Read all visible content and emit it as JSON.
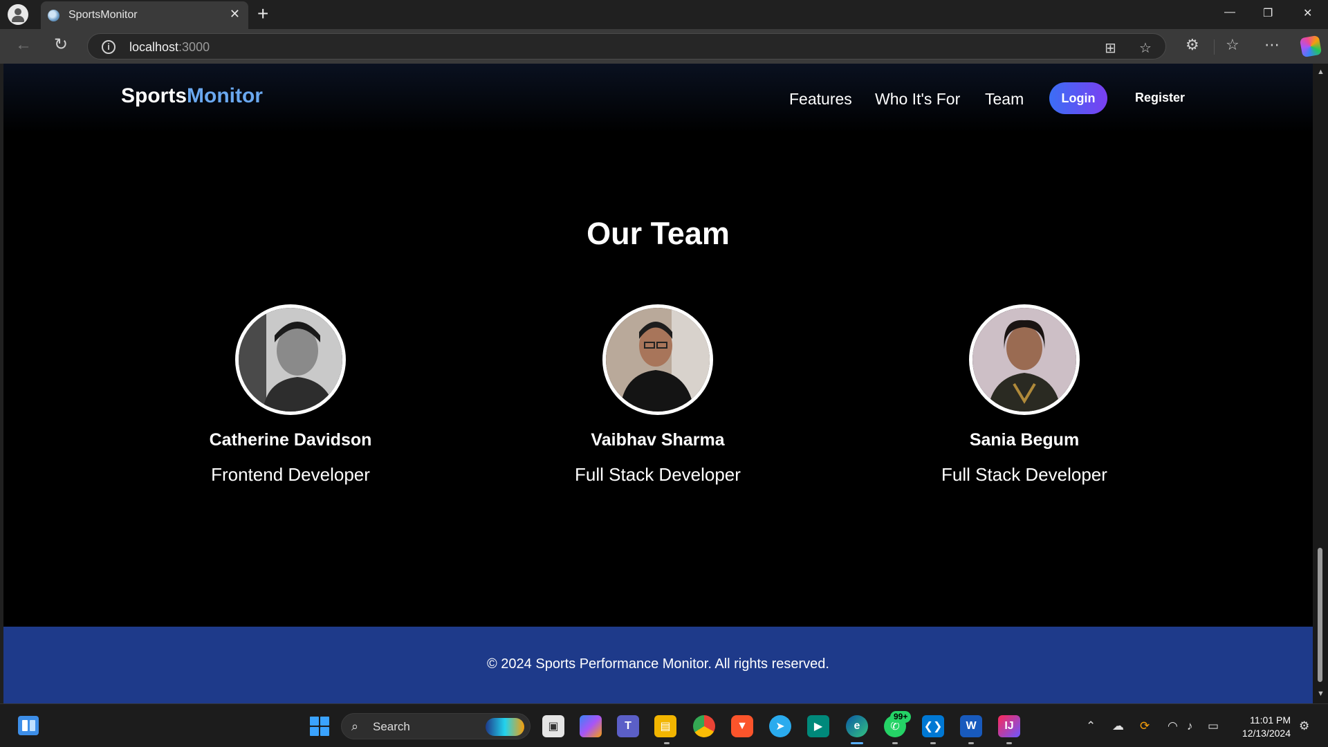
{
  "browser": {
    "tab_title": "SportsMonitor",
    "url_host": "localhost",
    "url_port": ":3000"
  },
  "site": {
    "brand_main": "Sports",
    "brand_accent": "Monitor",
    "nav": {
      "features": "Features",
      "who": "Who It's For",
      "team": "Team",
      "login": "Login",
      "register": "Register"
    }
  },
  "team": {
    "title": "Our Team",
    "members": [
      {
        "name": "Catherine Davidson",
        "role": "Frontend Developer"
      },
      {
        "name": "Vaibhav Sharma",
        "role": "Full Stack Developer"
      },
      {
        "name": "Sania Begum",
        "role": "Full Stack Developer"
      }
    ]
  },
  "footer": {
    "text": "© 2024 Sports Performance Monitor. All rights reserved."
  },
  "taskbar": {
    "search_label": "Search",
    "whatsapp_badge": "99+",
    "time": "11:01 PM",
    "date": "12/13/2024"
  },
  "colors": {
    "brand_accent": "#6aa8f0",
    "login_gradient_start": "#3b6ef5",
    "login_gradient_end": "#7a3ff2",
    "footer_bg": "#1e3a8a",
    "page_bg": "#000000"
  }
}
